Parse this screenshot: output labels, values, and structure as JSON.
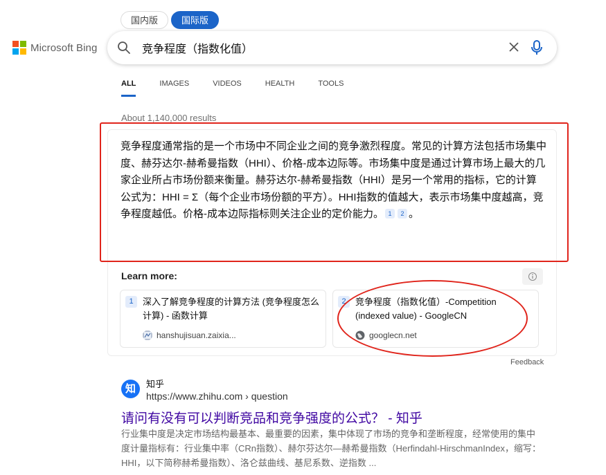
{
  "region_toggle": {
    "domestic": "国内版",
    "international": "国际版"
  },
  "logo": {
    "text": "Microsoft Bing",
    "colors": [
      "#f25022",
      "#7fba00",
      "#00a4ef",
      "#ffb900"
    ]
  },
  "search": {
    "query": "竞争程度（指数化值）",
    "icons": [
      "search-icon",
      "close-icon",
      "mic-icon"
    ]
  },
  "tabs": [
    {
      "label": "ALL",
      "active": true
    },
    {
      "label": "IMAGES"
    },
    {
      "label": "VIDEOS"
    },
    {
      "label": "HEALTH"
    },
    {
      "label": "TOOLS"
    }
  ],
  "results_count": "About 1,140,000 results",
  "answer": {
    "text": "竞争程度通常指的是一个市场中不同企业之间的竞争激烈程度。常见的计算方法包括市场集中度、赫芬达尔-赫希曼指数（HHI）、价格-成本边际等。市场集中度是通过计算市场上最大的几家企业所占市场份额来衡量。赫芬达尔-赫希曼指数（HHI）是另一个常用的指标，它的计算公式为：HHI = Σ（每个企业市场份额的平方）。HHI指数的值越大，表示市场集中度越高，竞争程度越低。价格-成本边际指标则关注企业的定价能力。",
    "citations": [
      "1",
      "2"
    ],
    "end": "。"
  },
  "learn_more": {
    "heading": "Learn more:",
    "sources": [
      {
        "num": "1",
        "title": "深入了解竞争程度的计算方法 (竞争程度怎么计算) - 函数计算",
        "site": "hanshujisuan.zaixia..."
      },
      {
        "num": "2",
        "title": "竞争程度（指数化值）-Competition (indexed value) - GoogleCN",
        "site": "googlecn.net"
      }
    ]
  },
  "feedback": "Feedback",
  "result": {
    "site_name": "知乎",
    "logo_char": "知",
    "url": "https://www.zhihu.com › question",
    "title": "请问有没有可以判断竞品和竞争强度的公式？ - 知乎",
    "snippet": "行业集中度是决定市场结构最基本、最重要的因素，集中体现了市场的竞争和垄断程度，经常使用的集中度计量指标有：行业集中率（CRn指数）、赫尔芬达尔—赫希曼指数（Herfindahl-HirschmanIndex，缩写：HHI，以下简称赫希曼指数）、洛仑兹曲线、基尼系数、逆指数 ..."
  },
  "accent_color": "#1b64c8",
  "annotation_color": "#e0241b"
}
